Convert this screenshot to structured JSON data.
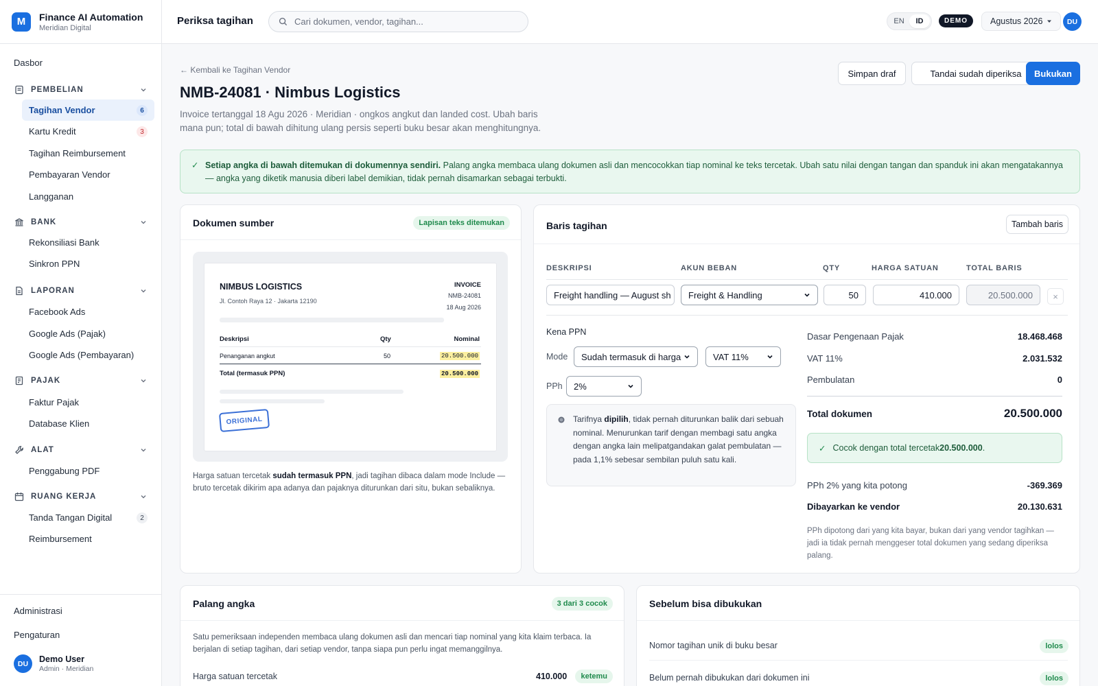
{
  "brand": {
    "name": "Finance AI Automation",
    "org": "Meridian Digital",
    "logo": "M"
  },
  "nav": {
    "dashboard": "Dasbor",
    "groups": [
      {
        "label": "PEMBELIAN",
        "icon": "receipt-icon",
        "items": [
          {
            "label": "Tagihan Vendor",
            "badge": "6",
            "active": true
          },
          {
            "label": "Kartu Kredit",
            "badge": "3"
          },
          {
            "label": "Tagihan Reimbursement"
          },
          {
            "label": "Pembayaran Vendor"
          },
          {
            "label": "Langganan"
          }
        ]
      },
      {
        "label": "BANK",
        "icon": "bank-icon",
        "items": [
          {
            "label": "Rekonsiliasi Bank"
          },
          {
            "label": "Sinkron PPN"
          }
        ]
      },
      {
        "label": "LAPORAN",
        "icon": "document-icon",
        "items": [
          {
            "label": "Facebook Ads"
          },
          {
            "label": "Google Ads (Pajak)"
          },
          {
            "label": "Google Ads (Pembayaran)"
          }
        ]
      },
      {
        "label": "PAJAK",
        "icon": "tax-icon",
        "items": [
          {
            "label": "Faktur Pajak"
          },
          {
            "label": "Database Klien"
          }
        ]
      },
      {
        "label": "ALAT",
        "icon": "wrench-icon",
        "items": [
          {
            "label": "Penggabung PDF"
          }
        ]
      },
      {
        "label": "RUANG KERJA",
        "icon": "calendar-icon",
        "items": [
          {
            "label": "Tanda Tangan Digital",
            "badge": "2"
          },
          {
            "label": "Reimbursement"
          }
        ]
      }
    ],
    "admin": "Administrasi",
    "settings": "Pengaturan"
  },
  "user": {
    "initials": "DU",
    "name": "Demo User",
    "role": "Admin · Meridian"
  },
  "topbar": {
    "title": "Periksa tagihan",
    "search_placeholder": "Cari dokumen, vendor, tagihan...",
    "lang": [
      "EN",
      "ID"
    ],
    "lang_active": "ID",
    "demo": "DEMO",
    "period": "Agustus 2026"
  },
  "page": {
    "back": "← Kembali ke Tagihan Vendor",
    "title": "NMB-24081 · Nimbus Logistics",
    "subtitle": "Invoice tertanggal 18 Agu 2026 · Meridian · ongkos angkut dan landed cost. Ubah baris mana pun; total di bawah dihitung ulang persis seperti buku besar akan menghitungnya.",
    "actions": {
      "draft": "Simpan draf",
      "mark": "Tandai sudah diperiksa",
      "post": "Bukukan"
    }
  },
  "banner": {
    "strong": "Setiap angka di bawah ditemukan di dokumennya sendiri.",
    "text": " Palang angka membaca ulang dokumen asli dan mencocokkan tiap nominal ke teks tercetak. Ubah satu nilai dengan tangan dan spanduk ini akan mengatakannya — angka yang diketik manusia diberi label demikian, tidak pernah disamarkan sebagai terbukti."
  },
  "source": {
    "title": "Dokumen sumber",
    "badge": "Lapisan teks ditemukan",
    "doc": {
      "vendor": "NIMBUS LOGISTICS",
      "address": "Jl. Contoh Raya 12 · Jakarta 12190",
      "kind": "INVOICE",
      "number": "NMB-24081",
      "date": "18 Aug 2026",
      "col_desc": "Deskripsi",
      "col_qty": "Qty",
      "col_amount": "Nominal",
      "row_desc": "Penanganan angkut",
      "row_qty": "50",
      "row_amount": "20.500.000",
      "total_label": "Total (termasuk PPN)",
      "total_amount": "20.500.000",
      "stamp": "ORIGINAL"
    },
    "note_pre": "Harga satuan tercetak ",
    "note_strong": "sudah termasuk PPN",
    "note_post": ", jadi tagihan dibaca dalam mode Include — bruto tercetak dikirim apa adanya dan pajaknya diturunkan dari situ, bukan sebaliknya."
  },
  "lines": {
    "title": "Baris tagihan",
    "add": "Tambah baris",
    "headers": {
      "desc": "DESKRIPSI",
      "account": "AKUN BEBAN",
      "qty": "QTY",
      "price": "HARGA SATUAN",
      "total": "TOTAL BARIS"
    },
    "row": {
      "desc": "Freight handling — August sh",
      "account": "Freight & Handling",
      "qty": "50",
      "price": "410.000",
      "total": "20.500.000",
      "remove": "×"
    },
    "tax": {
      "title": "Kena PPN",
      "mode_label": "Mode",
      "mode": "Sudah termasuk di harga",
      "vat": "VAT 11%",
      "pph_label": "PPh",
      "pph": "2%",
      "note_pre": "Tarifnya ",
      "note_strong": "dipilih",
      "note_post": ", tidak pernah diturunkan balik dari sebuah nominal. Menurunkan tarif dengan membagi satu angka dengan angka lain melipatgandakan galat pembulatan — pada 1,1% sebesar sembilan puluh satu kali."
    },
    "summary": {
      "dpp_label": "Dasar Pengenaan Pajak",
      "dpp": "18.468.468",
      "vat_label": "VAT 11%",
      "vat": "2.031.532",
      "round_label": "Pembulatan",
      "round": "0",
      "total_label": "Total dokumen",
      "total": "20.500.000",
      "match_pre": "Cocok dengan total tercetak ",
      "match_val": "20.500.000",
      "match_post": ".",
      "pph_label": "PPh 2% yang kita potong",
      "pph": "-369.369",
      "paid_label": "Dibayarkan ke vendor",
      "paid": "20.130.631",
      "note": "PPh dipotong dari yang kita bayar, bukan dari yang vendor tagihkan — jadi ia tidak pernah menggeser total dokumen yang sedang diperiksa palang."
    }
  },
  "guard": {
    "title": "Palang angka",
    "badge": "3 dari 3 cocok",
    "text": "Satu pemeriksaan independen membaca ulang dokumen asli dan mencari tiap nominal yang kita klaim terbaca. Ia berjalan di setiap tagihan, dari setiap vendor, tanpa siapa pun perlu ingat memanggilnya.",
    "row_label": "Harga satuan tercetak",
    "row_value": "410.000",
    "row_status": "ketemu"
  },
  "prepost": {
    "title": "Sebelum bisa dibukukan",
    "checks": [
      {
        "label": "Nomor tagihan unik di buku besar",
        "status": "lolos"
      },
      {
        "label": "Belum pernah dibukukan dari dokumen ini",
        "status": "lolos"
      }
    ]
  },
  "colors": {
    "accent": "#1a6fe0",
    "success": "#1f8a4c",
    "success_bg": "#e9f7ef",
    "highlight": "#fcef9f"
  }
}
